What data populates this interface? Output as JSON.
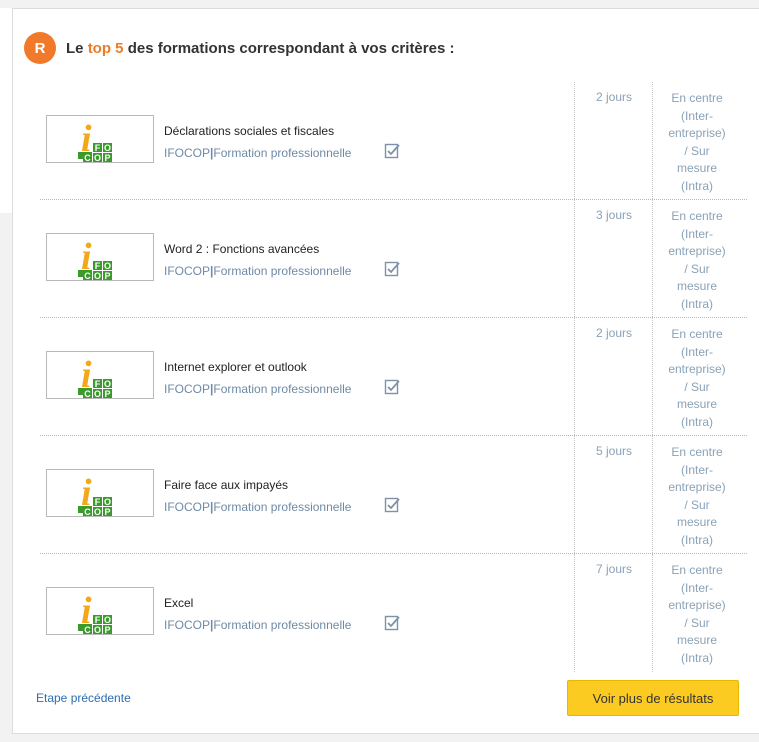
{
  "header": {
    "badge": "R",
    "title_prefix": "Le ",
    "title_accent": "top 5",
    "title_suffix": " des formations correspondant à vos critères :"
  },
  "logo": {
    "letter": "i",
    "cells": [
      "F",
      "O",
      "C",
      "O",
      "P"
    ],
    "colors": {
      "green": "#3a9a2b",
      "yellow": "#f2a81b"
    }
  },
  "results": [
    {
      "name": "Déclarations sociales et fiscales",
      "org": "IFOCOP",
      "sep": "|",
      "type": "Formation professionnelle",
      "duration": "2 jours",
      "mode": [
        "En centre",
        "(Inter-",
        "entreprise)",
        "/ Sur",
        "mesure",
        "(Intra)"
      ]
    },
    {
      "name": "Word 2 : Fonctions avancées",
      "org": "IFOCOP",
      "sep": "|",
      "type": "Formation professionnelle",
      "duration": "3 jours",
      "mode": [
        "En centre",
        "(Inter-",
        "entreprise)",
        "/ Sur",
        "mesure",
        "(Intra)"
      ]
    },
    {
      "name": "Internet explorer et outlook",
      "org": "IFOCOP",
      "sep": "|",
      "type": "Formation professionnelle",
      "duration": "2 jours",
      "mode": [
        "En centre",
        "(Inter-",
        "entreprise)",
        "/ Sur",
        "mesure",
        "(Intra)"
      ]
    },
    {
      "name": "Faire face aux impayés",
      "org": "IFOCOP",
      "sep": "|",
      "type": "Formation professionnelle",
      "duration": "5 jours",
      "mode": [
        "En centre",
        "(Inter-",
        "entreprise)",
        "/ Sur",
        "mesure",
        "(Intra)"
      ]
    },
    {
      "name": "Excel",
      "org": "IFOCOP",
      "sep": "|",
      "type": "Formation professionnelle",
      "duration": "7 jours",
      "mode": [
        "En centre",
        "(Inter-",
        "entreprise)",
        "/ Sur",
        "mesure",
        "(Intra)"
      ]
    }
  ],
  "footer": {
    "prev_label": "Etape précédente",
    "more_label": "Voir plus de résultats"
  },
  "colors": {
    "badge": "#f07a2a",
    "accent": "#ef7b22",
    "link": "#2a6db4",
    "muted": "#8aa2b7",
    "button": "#fccb21"
  }
}
